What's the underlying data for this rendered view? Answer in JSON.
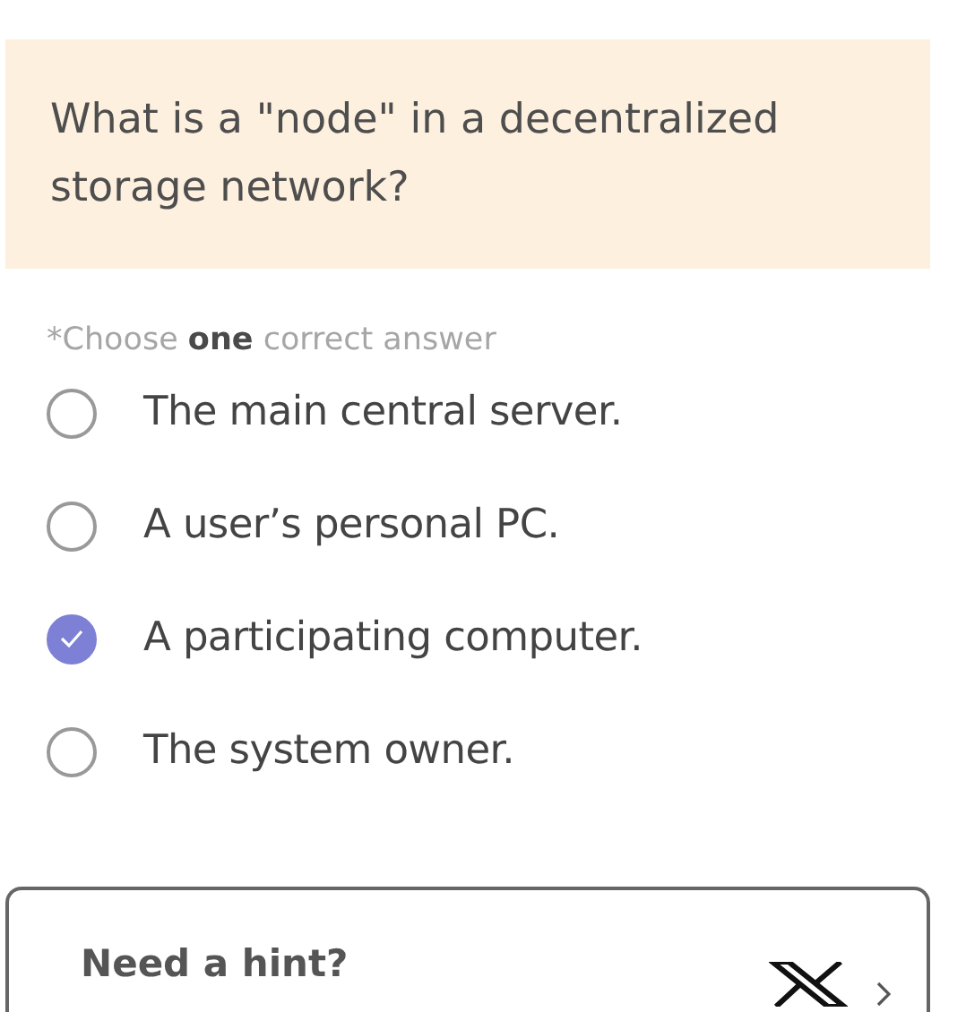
{
  "question": "What is a \"node\" in a decentralized storage network?",
  "instruction": "*Choose **one** correct answer",
  "options": [
    {
      "label": "The main central server.",
      "selected": false
    },
    {
      "label": "A user’s personal PC.",
      "selected": false
    },
    {
      "label": "A participating computer.",
      "selected": true
    },
    {
      "label": "The system owner.",
      "selected": false
    }
  ],
  "hint": {
    "label": "Need a hint?"
  }
}
